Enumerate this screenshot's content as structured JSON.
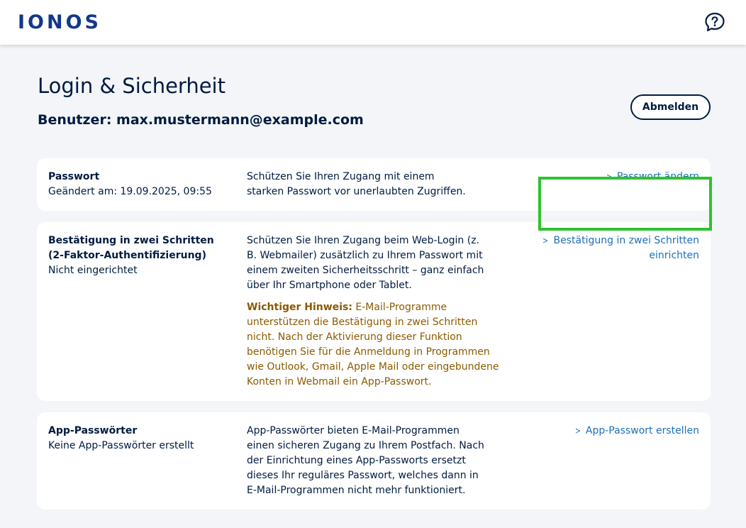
{
  "header": {
    "logo": "IONOS",
    "help_icon": "help-chat-icon"
  },
  "page": {
    "title": "Login & Sicherheit",
    "user_line": "Benutzer: max.mustermann@example.com",
    "logout_label": "Abmelden"
  },
  "cards": {
    "password": {
      "title": "Passwort",
      "subtitle": "Geändert am: 19.09.2025, 09:55",
      "description": "Schützen Sie Ihren Zugang mit einem starken Passwort vor unerlaubten Zugriffen.",
      "link": "Passwort ändern"
    },
    "two_factor": {
      "title_line1": "Bestätigung in zwei Schritten",
      "title_line2": "(2-Faktor-Authentifizierung)",
      "subtitle": "Nicht eingerichtet",
      "description": "Schützen Sie Ihren Zugang beim Web-Login (z. B. Webmailer) zusätzlich zu Ihrem Passwort mit einem zweiten Sicherheitsschritt – ganz einfach über Ihr Smartphone oder Tablet.",
      "note_label": "Wichtiger Hinweis:",
      "note_text": " E-Mail-Programme unterstützen die Bestätigung in zwei Schritten nicht. Nach der Aktivierung dieser Funktion benötigen Sie für die Anmeldung in Programmen wie Outlook, Gmail, Apple Mail oder eingebundene Konten in Webmail ein App-Passwort.",
      "link_line1": "Bestätigung in zwei Schritten",
      "link_line2": "einrichten"
    },
    "app_passwords": {
      "title": "App-Passwörter",
      "subtitle": "Keine App-Passwörter erstellt",
      "description": "App-Passwörter bieten E-Mail-Programmen einen sicheren Zugang zu Ihrem Postfach. Nach der Einrichtung eines App-Passworts ersetzt dieses Ihr reguläres Passwort, welches dann in E-Mail-Programmen nicht mehr funktioniert.",
      "link": "App-Passwort erstellen"
    }
  },
  "colors": {
    "brand": "#11388a",
    "text": "#001b41",
    "link": "#1d6fb8",
    "note": "#8a5a00",
    "highlight": "#2fc22f"
  }
}
